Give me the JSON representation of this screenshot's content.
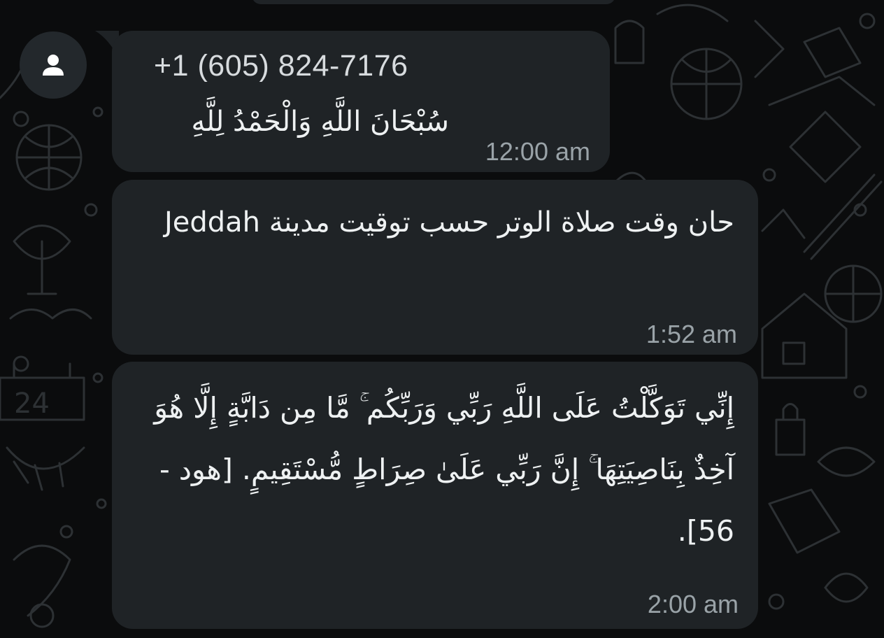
{
  "colors": {
    "background": "#0b0c0d",
    "bubble": "#1f2326",
    "text": "#e9edef",
    "meta": "#9aa3a8",
    "doodle": "#2d3134"
  },
  "messages": [
    {
      "sender": "+1 (605) 824-7176",
      "text": "سُبْحَانَ اللَّهِ وَالْحَمْدُ لِلَّهِ",
      "time": "12:00 am",
      "avatar_icon": "person-icon"
    },
    {
      "text": "حان وقت صلاة الوتر حسب توقيت مدينة Jeddah",
      "time": "1:52 am"
    },
    {
      "text": "إِنِّي تَوَكَّلْتُ عَلَى اللَّهِ رَبِّي وَرَبِّكُم ۚ مَّا مِن دَابَّةٍ إِلَّا هُوَ آخِذٌ بِنَاصِيَتِهَا ۚ إِنَّ رَبِّي عَلَىٰ صِرَاطٍ مُّسْتَقِيمٍ. [هود - 56].",
      "time": "2:00 am"
    }
  ]
}
